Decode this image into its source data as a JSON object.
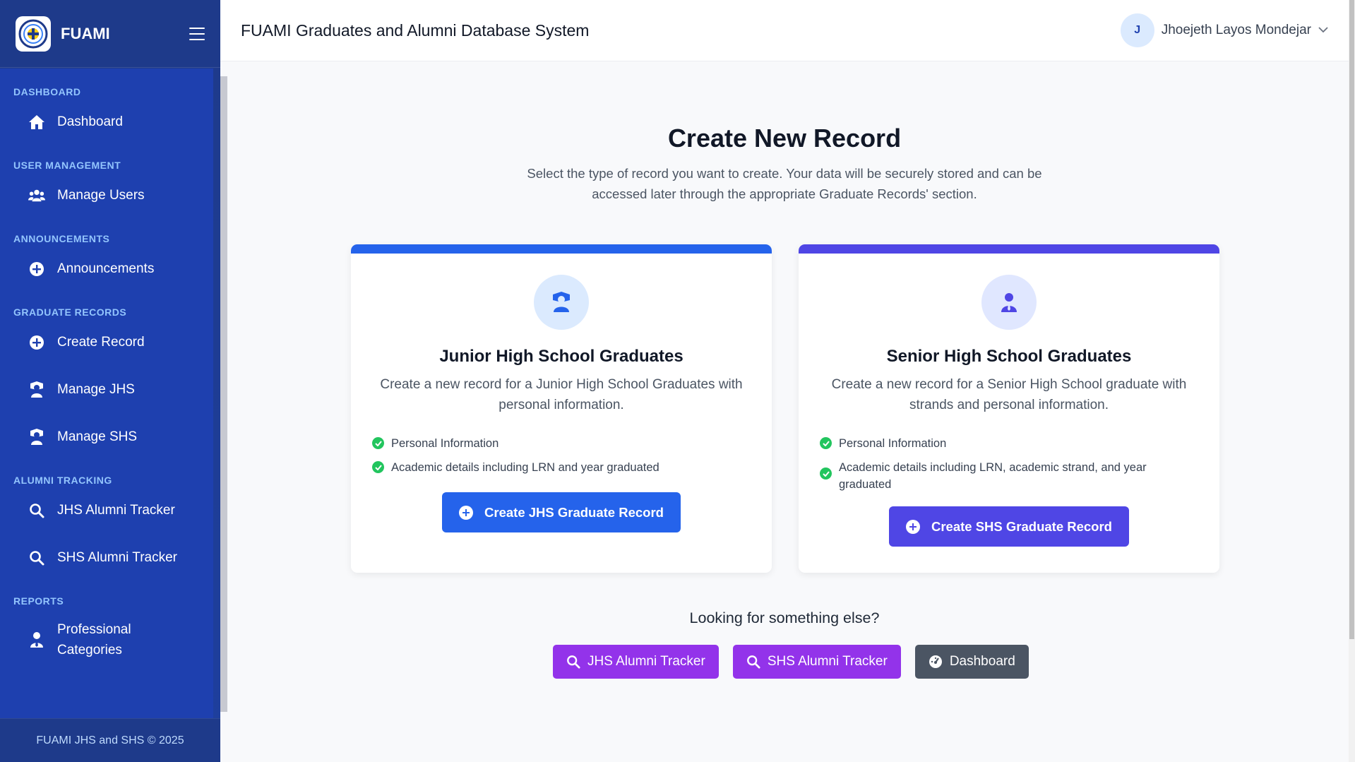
{
  "app": {
    "brand": "FUAMI",
    "title": "FUAMI Graduates and Alumni Database System"
  },
  "user": {
    "initial": "J",
    "name": "Jhoejeth Layos Mondejar"
  },
  "sidebar": {
    "sections": [
      {
        "title": "DASHBOARD",
        "items": [
          {
            "label": "Dashboard",
            "icon": "home-icon"
          }
        ]
      },
      {
        "title": "USER MANAGEMENT",
        "items": [
          {
            "label": "Manage Users",
            "icon": "users-icon"
          }
        ]
      },
      {
        "title": "ANNOUNCEMENTS",
        "items": [
          {
            "label": "Announcements",
            "icon": "plus-circle-icon"
          }
        ]
      },
      {
        "title": "GRADUATE RECORDS",
        "items": [
          {
            "label": "Create Record",
            "icon": "plus-circle-icon"
          },
          {
            "label": "Manage JHS",
            "icon": "graduate-icon"
          },
          {
            "label": "Manage SHS",
            "icon": "graduate-icon"
          }
        ]
      },
      {
        "title": "ALUMNI TRACKING",
        "items": [
          {
            "label": "JHS Alumni Tracker",
            "icon": "search-icon"
          },
          {
            "label": "SHS Alumni Tracker",
            "icon": "search-icon"
          }
        ]
      },
      {
        "title": "REPORTS",
        "items": [
          {
            "label": "Professional Categories",
            "icon": "user-tie-icon"
          }
        ]
      }
    ],
    "footer": "FUAMI JHS and SHS © 2025"
  },
  "main": {
    "title": "Create New Record",
    "subtitle": "Select the type of record you want to create. Your data will be securely stored and can be accessed later through the appropriate Graduate Records' section.",
    "cards": {
      "jhs": {
        "title": "Junior High School Graduates",
        "description": "Create a new record for a Junior High School Graduates with personal information.",
        "features": [
          "Personal Information",
          "Academic details including LRN and year graduated"
        ],
        "button": "Create JHS Graduate Record",
        "accent": "#2563eb"
      },
      "shs": {
        "title": "Senior High School Graduates",
        "description": "Create a new record for a Senior High School graduate with strands and personal information.",
        "features": [
          "Personal Information",
          "Academic details including LRN, academic strand, and year graduated"
        ],
        "button": "Create SHS Graduate Record",
        "accent": "#4f46e5"
      }
    },
    "else_title": "Looking for something else?",
    "quick_links": [
      "JHS Alumni Tracker",
      "SHS Alumni Tracker",
      "Dashboard"
    ]
  }
}
